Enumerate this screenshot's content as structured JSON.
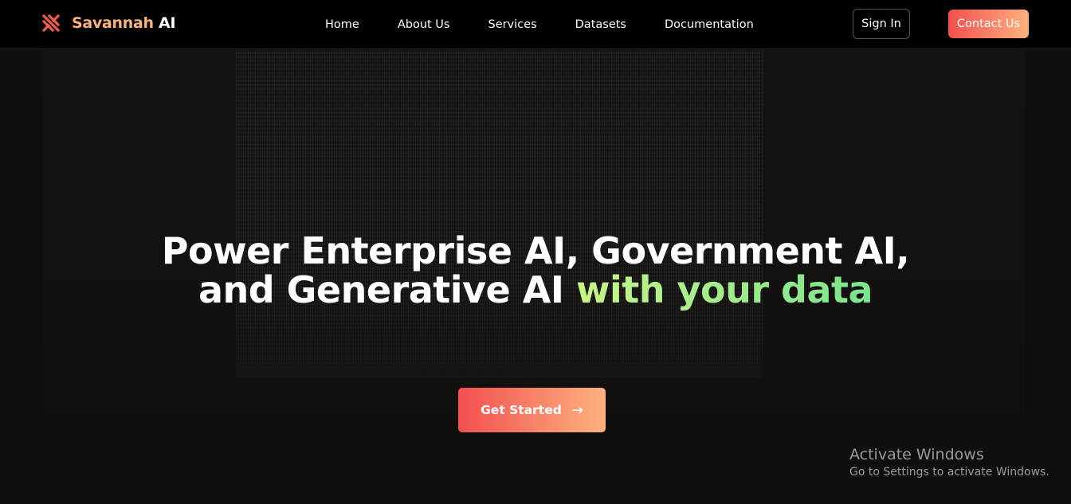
{
  "nav": {
    "brand_part1": "Savannah",
    "brand_part2": "AI",
    "logo_icon": "savannah-logo-icon",
    "links": [
      "Home",
      "About Us",
      "Services",
      "Datasets",
      "Documentation"
    ],
    "signin_label": "Sign In",
    "contact_label": "Contact Us"
  },
  "hero": {
    "headline_line1": "Power Enterprise AI, Government AI,",
    "headline_line2_plain": "and Generative AI ",
    "headline_line2_highlight": "with your data",
    "cta_label": "Get Started",
    "cta_icon": "arrow-right-icon"
  },
  "watermark": {
    "title": "Activate Windows",
    "subtitle": "Go to Settings to activate Windows."
  },
  "colors": {
    "accent_start": "#f2504f",
    "accent_end": "#fdb27f",
    "highlight_start": "#c9f48a",
    "highlight_end": "#7be38f",
    "background": "#0d0d0d"
  }
}
